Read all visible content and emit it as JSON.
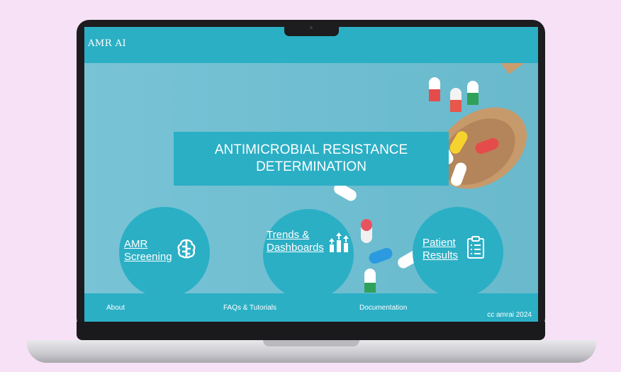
{
  "app": {
    "brand": "AMR  AI"
  },
  "hero": {
    "title": "ANTIMICROBIAL RESISTANCE DETERMINATION"
  },
  "features": [
    {
      "line1": "AMR",
      "line2": "Screening",
      "icon": "brain-icon"
    },
    {
      "line1": "Trends &",
      "line2": "Dashboards",
      "icon": "bar-chart-up-icon"
    },
    {
      "line1": "Patient",
      "line2": "Results",
      "icon": "clipboard-icon"
    }
  ],
  "footer": {
    "links": [
      "About",
      "FAQs & Tutorials",
      "Documentation"
    ],
    "copyright": "cc amrai 2024"
  },
  "colors": {
    "accent": "#2bafc5",
    "background": "#f6e1f6",
    "hero": "#6fc0d4"
  }
}
